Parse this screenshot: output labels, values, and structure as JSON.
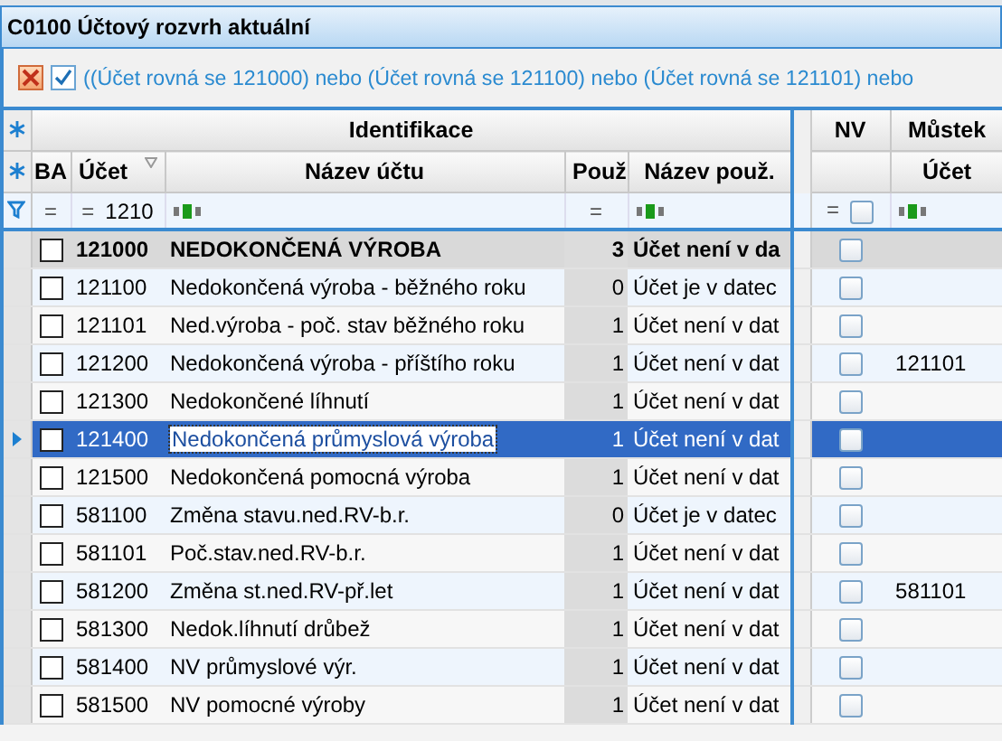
{
  "window": {
    "title": "C0100 Účtový rozvrh aktuální"
  },
  "filter_bar": {
    "text": "((Účet rovná se 121000) nebo (Účet rovná se 121100) nebo (Účet rovná se 121101) nebo",
    "enabled": true
  },
  "header_groups": [
    {
      "label": "Identifikace"
    },
    {
      "label": "NV"
    },
    {
      "label": "Můstek"
    }
  ],
  "columns": [
    {
      "label": "BA"
    },
    {
      "label": "Účet"
    },
    {
      "label": "Název účtu"
    },
    {
      "label": "Použ"
    },
    {
      "label": "Název použ."
    },
    {
      "label": "Účet"
    }
  ],
  "filter_row": {
    "ba_operator": "=",
    "account_operator": "=",
    "account_value": "1210",
    "usage_operator": "=",
    "nv_operator": "=",
    "nv_checked": false
  },
  "rows": [
    {
      "kind": "group",
      "selected": false,
      "ba_checked": false,
      "account": "121000",
      "name": "NEDOKONČENÁ VÝROBA",
      "usage": "3",
      "usage_name": "Účet není v da",
      "nv_checked": false,
      "bridge_account": ""
    },
    {
      "kind": "account",
      "selected": false,
      "ba_checked": false,
      "account": "121100",
      "name": "Nedokončená výroba - běžného roku",
      "usage": "0",
      "usage_name": "Účet je v datec",
      "nv_checked": false,
      "bridge_account": ""
    },
    {
      "kind": "account",
      "selected": false,
      "ba_checked": false,
      "account": "121101",
      "name": "Ned.výroba - poč. stav běžného roku",
      "usage": "1",
      "usage_name": "Účet není v dat",
      "nv_checked": false,
      "bridge_account": ""
    },
    {
      "kind": "account",
      "selected": false,
      "ba_checked": false,
      "account": "121200",
      "name": "Nedokončená výroba - příštího roku",
      "usage": "1",
      "usage_name": "Účet není v dat",
      "nv_checked": false,
      "bridge_account": "121101"
    },
    {
      "kind": "account",
      "selected": false,
      "ba_checked": false,
      "account": "121300",
      "name": "Nedokončené líhnutí",
      "usage": "1",
      "usage_name": "Účet není v dat",
      "nv_checked": false,
      "bridge_account": ""
    },
    {
      "kind": "account",
      "selected": true,
      "ba_checked": false,
      "account": "121400",
      "name": "Nedokončená průmyslová výroba",
      "usage": "1",
      "usage_name": "Účet není v dat",
      "nv_checked": false,
      "bridge_account": ""
    },
    {
      "kind": "account",
      "selected": false,
      "ba_checked": false,
      "account": "121500",
      "name": "Nedokončená pomocná výroba",
      "usage": "1",
      "usage_name": "Účet není v dat",
      "nv_checked": false,
      "bridge_account": ""
    },
    {
      "kind": "account",
      "selected": false,
      "ba_checked": false,
      "account": "581100",
      "name": "Změna stavu.ned.RV-b.r.",
      "usage": "0",
      "usage_name": "Účet je v datec",
      "nv_checked": false,
      "bridge_account": ""
    },
    {
      "kind": "account",
      "selected": false,
      "ba_checked": false,
      "account": "581101",
      "name": "Poč.stav.ned.RV-b.r.",
      "usage": "1",
      "usage_name": "Účet není v dat",
      "nv_checked": false,
      "bridge_account": ""
    },
    {
      "kind": "account",
      "selected": false,
      "ba_checked": false,
      "account": "581200",
      "name": "Změna st.ned.RV-př.let",
      "usage": "1",
      "usage_name": "Účet není v dat",
      "nv_checked": false,
      "bridge_account": "581101"
    },
    {
      "kind": "account",
      "selected": false,
      "ba_checked": false,
      "account": "581300",
      "name": "Nedok.líhnutí drůbež",
      "usage": "1",
      "usage_name": "Účet není v dat",
      "nv_checked": false,
      "bridge_account": ""
    },
    {
      "kind": "account",
      "selected": false,
      "ba_checked": false,
      "account": "581400",
      "name": "NV průmyslové výr.",
      "usage": "1",
      "usage_name": "Účet není v dat",
      "nv_checked": false,
      "bridge_account": ""
    },
    {
      "kind": "account",
      "selected": false,
      "ba_checked": false,
      "account": "581500",
      "name": "NV pomocné výroby",
      "usage": "1",
      "usage_name": "Účet není v dat",
      "nv_checked": false,
      "bridge_account": ""
    }
  ]
}
